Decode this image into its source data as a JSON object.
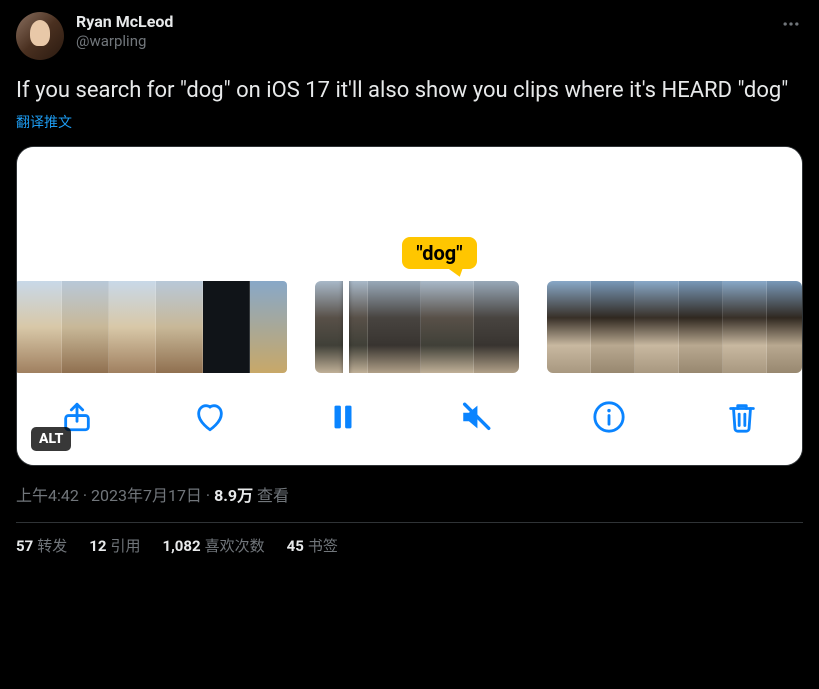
{
  "author": {
    "display_name": "Ryan McLeod",
    "handle": "@warpling"
  },
  "tweet_text": "If you search for \"dog\" on iOS 17 it'll also show you clips where it's HEARD \"dog\"",
  "translate_label": "翻译推文",
  "media": {
    "tooltip_label": "\"dog\"",
    "alt_badge": "ALT"
  },
  "meta": {
    "time": "上午4:42",
    "date": "2023年7月17日",
    "views_value": "8.9万",
    "views_label": "查看"
  },
  "stats": {
    "retweets_count": "57",
    "retweets_label": "转发",
    "quotes_count": "12",
    "quotes_label": "引用",
    "likes_count": "1,082",
    "likes_label": "喜欢次数",
    "bookmarks_count": "45",
    "bookmarks_label": "书签"
  }
}
